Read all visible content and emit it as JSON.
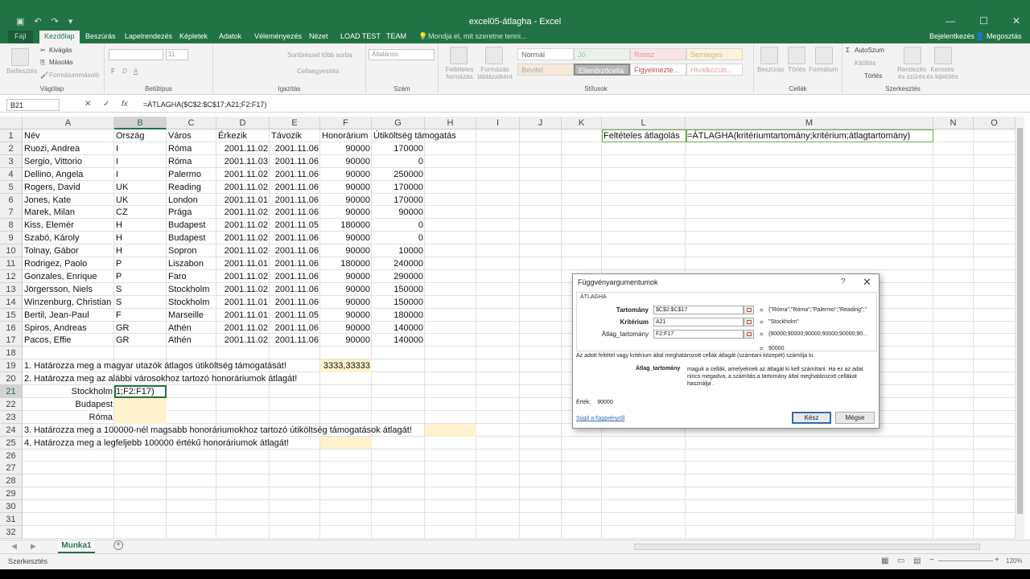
{
  "window": {
    "title": "excel05-átlagha - Excel",
    "controls": [
      "—",
      "☐",
      "✕"
    ],
    "qat_icons": [
      "save-icon",
      "undo-icon",
      "redo-icon",
      "customize-qat-icon"
    ],
    "qat_glyphs": [
      "▣",
      "↶",
      "↷",
      "▾"
    ]
  },
  "tabs": [
    "Fájl",
    "Kezdőlap",
    "Beszúrás",
    "Lapelrendezés",
    "Képletek",
    "Adatok",
    "Véleményezés",
    "Nézet",
    "LOAD TEST",
    "TEAM"
  ],
  "tell_me": "Mondja el, mit szeretne tenni...",
  "signin": "Bejelentkezés",
  "share": "Megosztás",
  "ribbon": {
    "clipboard": {
      "paste": "Beillesztés",
      "cut": "Kivágás",
      "copy": "Másolás",
      "format_painter": "Formátummásoló",
      "label": "Vágólap"
    },
    "font": {
      "name": "",
      "size": "11",
      "bold": "F",
      "italic": "D",
      "underline": "A",
      "label": "Betűtípus"
    },
    "alignment": {
      "wrap": "Sortöréssel több sorba",
      "merge": "Cellaegyesítés",
      "label": "Igazítás"
    },
    "number": {
      "format": "Általános",
      "label": "Szám"
    },
    "styles": {
      "conditional": "Feltételes formázás",
      "format_table": "Formázás táblázatként",
      "cells": [
        "Normál",
        "Jó",
        "Rossz",
        "Semleges",
        "Bevitel",
        "Ellenőrzőcella",
        "Figyelmezte...",
        "Hivatkozott..."
      ],
      "label": "Stílusok"
    },
    "cells": {
      "insert": "Beszúrás",
      "delete": "Törlés",
      "format": "Formátum",
      "label": "Cellák"
    },
    "editing": {
      "autosum": "AutoSzum",
      "fill": "Kitöltés",
      "clear": "Törlés",
      "sort": "Rendezés és szűrés",
      "find": "Keresés és kijelölés",
      "label": "Szerkesztés"
    }
  },
  "formula_bar": {
    "name_box": "B21",
    "cancel": "✕",
    "enter": "✓",
    "fx": "fx",
    "formula": "=ÁTLAGHA($C$2:$C$17;A21;F2:F17)"
  },
  "columns": [
    "A",
    "B",
    "C",
    "D",
    "E",
    "F",
    "G",
    "H",
    "I",
    "J",
    "K",
    "L",
    "M",
    "N",
    "O"
  ],
  "rows": [
    "1",
    "2",
    "3",
    "4",
    "5",
    "6",
    "7",
    "8",
    "9",
    "10",
    "11",
    "12",
    "13",
    "14",
    "15",
    "16",
    "17",
    "18",
    "19",
    "20",
    "21",
    "22",
    "23",
    "24",
    "25",
    "26",
    "27",
    "28",
    "29",
    "30",
    "31",
    "32"
  ],
  "headers": [
    "Név",
    "Ország",
    "Város",
    "Érkezik",
    "Távozik",
    "Honorárium",
    "Útiköltség támogatás"
  ],
  "data": [
    [
      "Ruozi, Andrea",
      "I",
      "Róma",
      "2001.11.02",
      "2001.11.06",
      "90000",
      "170000"
    ],
    [
      "Sergio, Vittorio",
      "I",
      "Róma",
      "2001.11.03",
      "2001.11.06",
      "90000",
      "0"
    ],
    [
      "Dellino, Angela",
      "I",
      "Palermo",
      "2001.11.02",
      "2001.11.06",
      "90000",
      "250000"
    ],
    [
      "Rogers, David",
      "UK",
      "Reading",
      "2001.11.02",
      "2001.11.06",
      "90000",
      "170000"
    ],
    [
      "Jones, Kate",
      "UK",
      "London",
      "2001.11.01",
      "2001.11.06",
      "90000",
      "170000"
    ],
    [
      "Marek, Milan",
      "CZ",
      "Prága",
      "2001.11.02",
      "2001.11.06",
      "90000",
      "90000"
    ],
    [
      "Kiss, Elemér",
      "H",
      "Budapest",
      "2001.11.02",
      "2001.11.05",
      "180000",
      "0"
    ],
    [
      "Szabó, Károly",
      "H",
      "Budapest",
      "2001.11.02",
      "2001.11.06",
      "90000",
      "0"
    ],
    [
      "Tolnay, Gábor",
      "H",
      "Sopron",
      "2001.11.02",
      "2001.11.06",
      "90000",
      "10000"
    ],
    [
      "Rodrigez, Paolo",
      "P",
      "Liszabon",
      "2001.11.01",
      "2001.11.06",
      "180000",
      "240000"
    ],
    [
      "Gonzales, Enrique",
      "P",
      "Faro",
      "2001.11.02",
      "2001.11.06",
      "90000",
      "290000"
    ],
    [
      "Jörgersson, Niels",
      "S",
      "Stockholm",
      "2001.11.02",
      "2001.11.06",
      "90000",
      "150000"
    ],
    [
      "Winzenburg, Christian",
      "S",
      "Stockholm",
      "2001.11.01",
      "2001.11.06",
      "90000",
      "150000"
    ],
    [
      "Bertil, Jean-Paul",
      "F",
      "Marseille",
      "2001.11.01",
      "2001.11.05",
      "90000",
      "180000"
    ],
    [
      "Spiros, Andreas",
      "GR",
      "Athén",
      "2001.11.02",
      "2001.11.06",
      "90000",
      "140000"
    ],
    [
      "Pacos, Effie",
      "GR",
      "Athén",
      "2001.11.02",
      "2001.11.06",
      "90000",
      "140000"
    ]
  ],
  "tasks": {
    "q1": "1. Határozza meg a magyar utazók átlagos útiköltség támogatását!",
    "q1_result": "3333,33333",
    "q2": "2. Határozza meg az alábbi városokhoz tartozó honoráriumok átlagát!",
    "city1": "Stockholm",
    "city2": "Budapest",
    "city3": "Róma",
    "b21_edit": "1;F2:F17)",
    "q3": "3. Határozza meg a 100000-nél magsabb honoráriumokhoz tartozó útiköltség támogatások átlagát!",
    "q4": "4. Határozza meg a legfeljebb 100000 értékű honoráriumok átlagát!"
  },
  "side_note": {
    "label": "Feltételes átlagolás",
    "syntax": "=ÁTLAGHA(kritériumtartomány;kritérium;átlagtartomány)"
  },
  "dialog": {
    "title": "Függvényargumentumok",
    "help": "?",
    "close": "✕",
    "function": "ÁTLAGHA",
    "args": [
      {
        "label": "Tartomány",
        "value": "$C$2:$C$17",
        "result": "{\"Róma\";\"Róma\";\"Palermo\";\"Reading\";\""
      },
      {
        "label": "Kritérium",
        "value": "A21",
        "result": "\"Stockholm\""
      },
      {
        "label": "Átlag_tartomány",
        "value": "F2:F17",
        "result": "{90000;90000;90000;90000;90000;90..."
      }
    ],
    "eq": "=",
    "total": "90000",
    "description": "Az adott feltétel vagy kritérium által meghatározott cellák átlagát (számtani közepét) számítja ki.",
    "arg_name": "Átlag_tartomány",
    "arg_desc": "maguk a cellák, amelyeknek az átlagát ki kell számítani. Ha ez az adat nincs megadva, a számítás a tartomány által meghatározott cellákat használja .",
    "value_label": "Érték:",
    "value": "90000",
    "help_link": "Súgó a függvényről",
    "ok": "Kész",
    "cancel": "Mégse"
  },
  "sheet_tab": "Munka1",
  "add_sheet": "+",
  "status": "Szerkesztés",
  "zoom": "120%",
  "colors": {
    "accent": "#217346",
    "input_fill": "#fff2cc",
    "green_border": "#70ad47"
  }
}
